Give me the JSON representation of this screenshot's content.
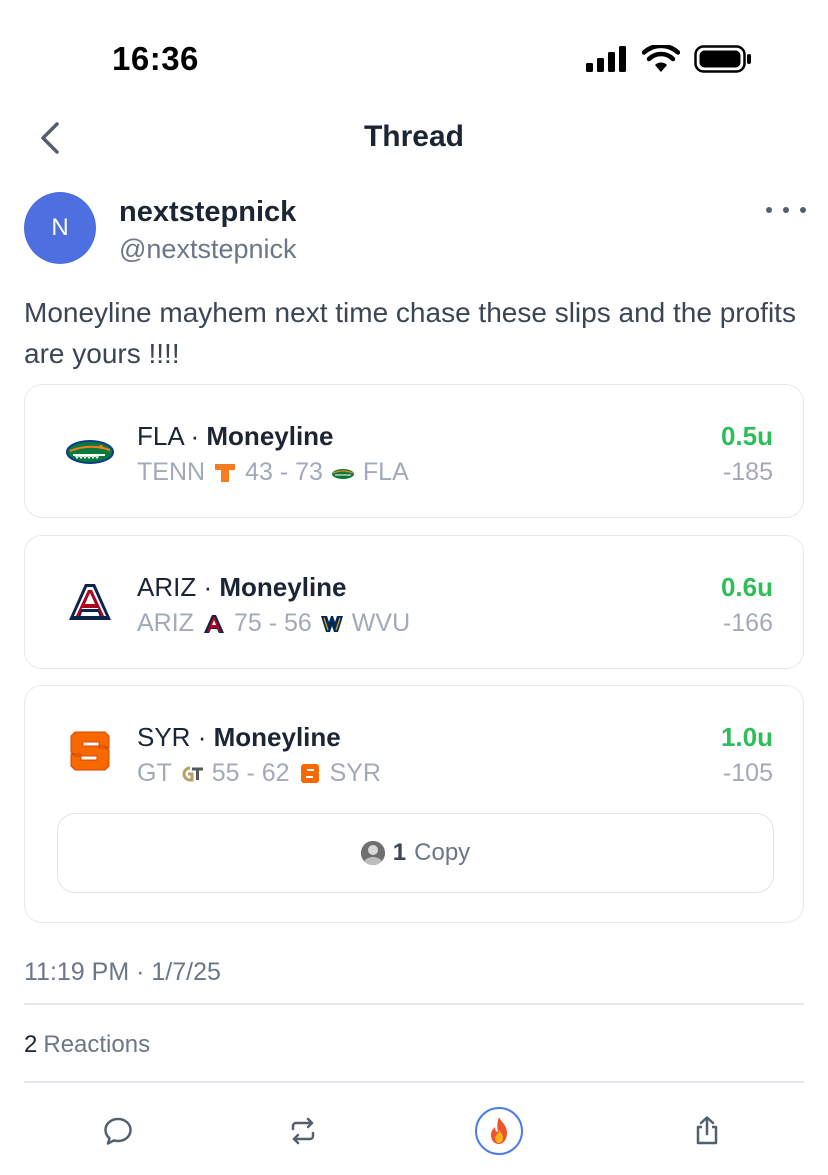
{
  "status_bar": {
    "time": "16:36",
    "icons": [
      "signal-icon",
      "wifi-icon",
      "battery-icon"
    ]
  },
  "nav": {
    "back_icon": "chevron-left-icon",
    "title": "Thread"
  },
  "post": {
    "avatar_initial": "N",
    "avatar_color": "#4e6fe0",
    "display_name": "nextstepnick",
    "handle": "@nextstepnick",
    "more_icon": "more-horizontal-icon",
    "text": "Moneyline mayhem next time chase these slips and the profits are yours !!!!",
    "bets": [
      {
        "team": "FLA",
        "separator": "·",
        "bet_type": "Moneyline",
        "away_team": "TENN",
        "away_logo": "tennessee-logo",
        "score": "43 - 73",
        "home_logo": "florida-logo",
        "home_team": "FLA",
        "units": "0.5u",
        "odds": "-185",
        "logo": "florida-gators-logo"
      },
      {
        "team": "ARIZ",
        "separator": "·",
        "bet_type": "Moneyline",
        "away_team": "ARIZ",
        "away_logo": "arizona-logo",
        "score": "75 - 56",
        "home_logo": "west-virginia-logo",
        "home_team": "WVU",
        "units": "0.6u",
        "odds": "-166",
        "logo": "arizona-wildcats-logo"
      },
      {
        "team": "SYR",
        "separator": "·",
        "bet_type": "Moneyline",
        "away_team": "GT",
        "away_logo": "georgia-tech-logo",
        "score": "55 - 62",
        "home_logo": "syracuse-logo",
        "home_team": "SYR",
        "units": "1.0u",
        "odds": "-105",
        "logo": "syracuse-orange-logo"
      }
    ],
    "copy": {
      "count": "1",
      "label": "Copy"
    },
    "timestamp": "11:19 PM · 1/7/25",
    "reactions": {
      "count": "2",
      "label": "Reactions"
    }
  },
  "actions": {
    "reply_icon": "reply-icon",
    "repost_icon": "repost-icon",
    "fire_icon": "fire-icon",
    "share_icon": "share-icon"
  },
  "colors": {
    "accent_green": "#2ebd59",
    "muted_text": "#a2aab9",
    "primary_text": "#1b2533",
    "fire_ring": "#4b7bec"
  }
}
